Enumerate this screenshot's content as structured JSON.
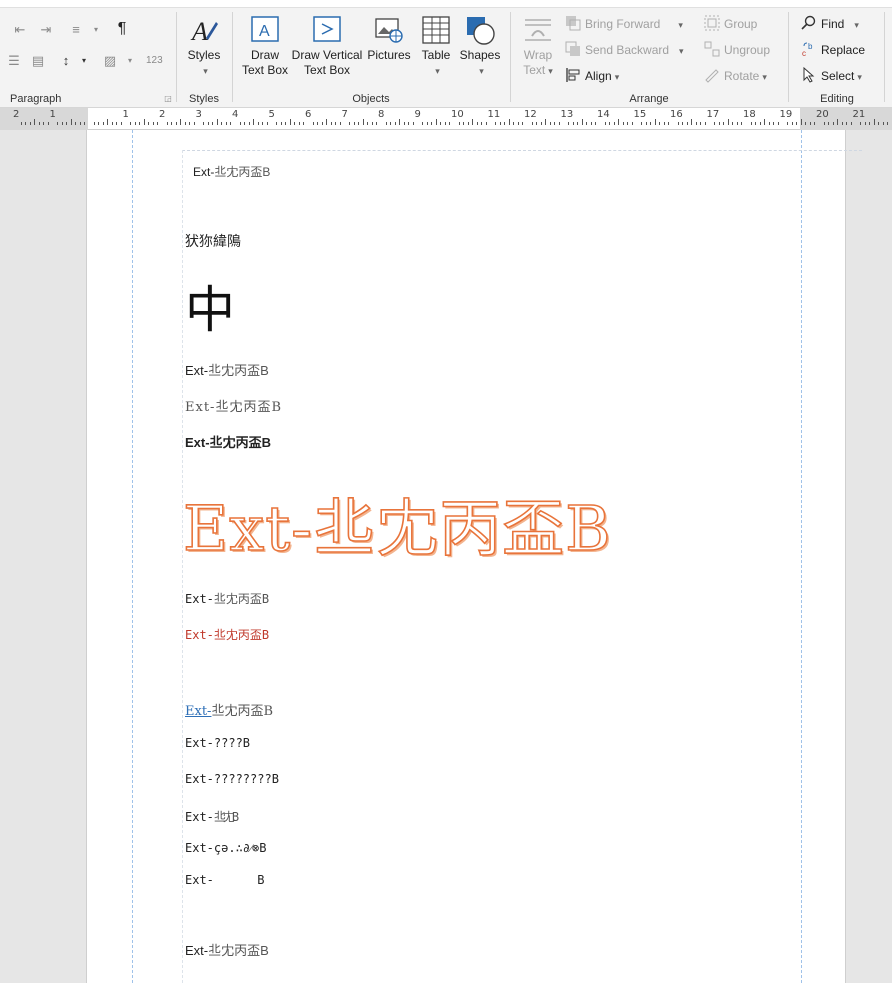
{
  "ribbon": {
    "paragraph": {
      "label": "Paragraph",
      "pilcrow": "¶"
    },
    "styles": {
      "button": "Styles",
      "label": "Styles"
    },
    "objects": {
      "label": "Objects",
      "draw_text_box": [
        "Draw",
        "Text Box"
      ],
      "draw_vertical_text_box": [
        "Draw Vertical",
        "Text Box"
      ],
      "pictures": "Pictures",
      "table": "Table",
      "shapes": "Shapes"
    },
    "arrange": {
      "label": "Arrange",
      "wrap_text": [
        "Wrap",
        "Text"
      ],
      "bring_forward": "Bring Forward",
      "send_backward": "Send Backward",
      "align": "Align",
      "group": "Group",
      "ungroup": "Ungroup",
      "rotate": "Rotate"
    },
    "editing": {
      "label": "Editing",
      "find": "Find",
      "replace": "Replace",
      "select": "Select"
    }
  },
  "ruler": {
    "numbers": [
      "2",
      "1",
      "",
      "1",
      "2",
      "3",
      "4",
      "5",
      "6",
      "7",
      "8",
      "9",
      "10",
      "11",
      "12",
      "13",
      "14",
      "15",
      "16",
      "17",
      "18",
      "19",
      "20",
      "21"
    ]
  },
  "document": {
    "header_text": {
      "latin": "Ext-",
      "cjk": "丠冘丙盃B"
    },
    "line1": "犾狝緯隝",
    "big_char": "中",
    "line3": {
      "latin": "Ext-",
      "cjk": "丠冘丙盃B"
    },
    "line4": {
      "latin": "Ext-",
      "cjk": "丠冘丙盃B"
    },
    "line5": {
      "latin": "Ext-",
      "cjk": "丠冘丙盃B"
    },
    "outline_line": "Ext-丠冘丙盃B",
    "line7": {
      "latin": "Ext-",
      "cjk": "丠冘丙盃B"
    },
    "line8": {
      "latin": "Ext-",
      "cjk": "丠冘丙盃B"
    },
    "line9": {
      "latin": "Ext-",
      "cjk": "丠冘丙盃B"
    },
    "line10": "Ext-????B",
    "line11": "Ext-????????B",
    "line12": {
      "latin": "Ext-",
      "cjk": "丠冘B"
    },
    "line13": "Ext-çə.∴∂⁄⊗B",
    "line14": "Ext-      B",
    "line15": {
      "latin": "Ext-",
      "cjk": "丠冘丙盃B"
    }
  },
  "colors": {
    "red": "#c0392b",
    "blue": "#2e6fb7",
    "outline": "#e8743b",
    "accent": "#2b579a"
  }
}
